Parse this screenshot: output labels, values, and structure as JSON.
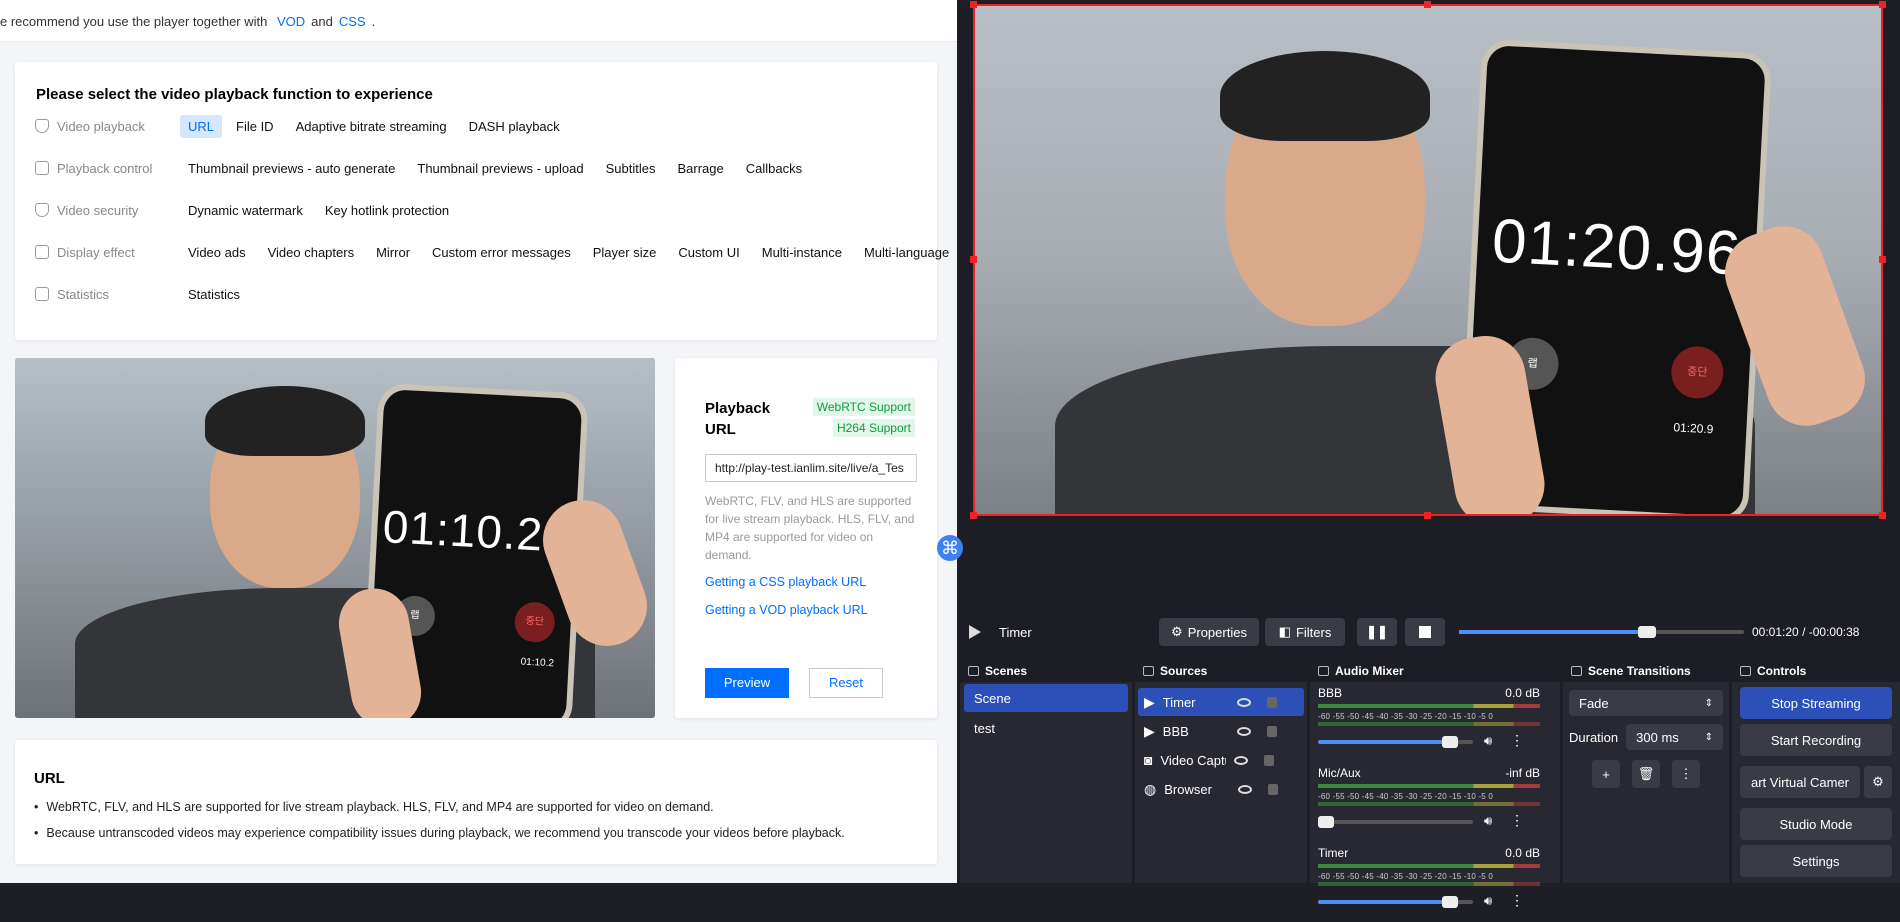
{
  "top_note": {
    "prefix": "e recommend you use the player together with",
    "vod_link": "VOD",
    "and": "and",
    "css_link": "CSS",
    "suffix": "."
  },
  "functions": {
    "title": "Please select the video playback function to experience",
    "rows": [
      {
        "label": "Video playback",
        "icon": "shield-check-icon",
        "options": [
          "URL",
          "File ID",
          "Adaptive bitrate streaming",
          "DASH playback"
        ],
        "active": 0
      },
      {
        "label": "Playback control",
        "icon": "playback-control-icon",
        "options": [
          "Thumbnail previews - auto generate",
          "Thumbnail previews - upload",
          "Subtitles",
          "Barrage",
          "Callbacks"
        ],
        "active": -1
      },
      {
        "label": "Video security",
        "icon": "shield-check-icon",
        "options": [
          "Dynamic watermark",
          "Key hotlink protection"
        ],
        "active": -1
      },
      {
        "label": "Display effect",
        "icon": "monitor-icon",
        "options": [
          "Video ads",
          "Video chapters",
          "Mirror",
          "Custom error messages",
          "Player size",
          "Custom UI",
          "Multi-instance",
          "Multi-language"
        ],
        "active": -1
      },
      {
        "label": "Statistics",
        "icon": "bar-chart-icon",
        "options": [
          "Statistics"
        ],
        "active": -1
      }
    ]
  },
  "left_video": {
    "phone_time": "01:10.28",
    "small_time": "01:10.2",
    "lap_label": "랩 1",
    "lap_button": "랩",
    "stop_button": "중단"
  },
  "playback": {
    "title": "Playback URL",
    "badge_webrtc": "WebRTC Support",
    "badge_h264": "H264 Support",
    "url_value": "http://play-test.ianlim.site/live/a_Tes",
    "description": "WebRTC, FLV, and HLS are supported for live stream playback. HLS, FLV, and MP4 are supported for video on demand.",
    "link_css": "Getting a CSS playback URL",
    "link_vod": "Getting a VOD playback URL",
    "preview_label": "Preview",
    "reset_label": "Reset"
  },
  "url_section": {
    "title": "URL",
    "bullets": [
      "WebRTC, FLV, and HLS are supported for live stream playback. HLS, FLV, and MP4 are supported for video on demand.",
      "Because untranscoded videos may experience compatibility issues during playback, we recommend you transcode your videos before playback."
    ]
  },
  "obs": {
    "preview_time": "01:20.96",
    "preview_small_time": "01:20.9",
    "lap_label": "랩 1",
    "lap_button": "랩",
    "stop_button": "중단",
    "media_name": "Timer",
    "properties_label": "Properties",
    "filters_label": "Filters",
    "time_elapsed": "00:01:20",
    "time_sep": "/",
    "time_remaining": "-00:00:38",
    "progress": 0.66,
    "scenes_title": "Scenes",
    "scenes": [
      "Scene",
      "test"
    ],
    "sources_title": "Sources",
    "sources": [
      {
        "name": "Timer",
        "icon": "play-icon"
      },
      {
        "name": "BBB",
        "icon": "play-icon"
      },
      {
        "name": "Video Capture Device",
        "icon": "camera-icon"
      },
      {
        "name": "Browser",
        "icon": "globe-icon"
      }
    ],
    "mixer_title": "Audio Mixer",
    "mixer": [
      {
        "name": "BBB",
        "level": "0.0 dB",
        "volume": 0.85
      },
      {
        "name": "Mic/Aux",
        "level": "-inf dB",
        "volume": 0.05
      },
      {
        "name": "Timer",
        "level": "0.0 dB",
        "volume": 0.85
      }
    ],
    "scale": "-60 -55 -50 -45 -40 -35 -30 -25 -20 -15 -10  -5   0",
    "transitions_title": "Scene Transitions",
    "transition": "Fade",
    "duration_label": "Duration",
    "duration_value": "300 ms",
    "controls_title": "Controls",
    "controls": [
      "Stop Streaming",
      "Start Recording",
      "art Virtual Camer",
      "Studio Mode",
      "Settings"
    ],
    "colors": {
      "accent": "#2c4fb8",
      "selection_border": "#e22222"
    }
  }
}
